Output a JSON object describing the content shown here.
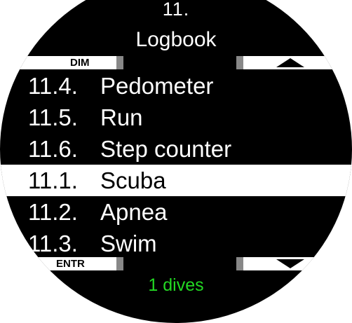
{
  "header": {
    "number": "11.",
    "title": "Logbook"
  },
  "buttons": {
    "top_left": "DIM",
    "bottom_left": "ENTR",
    "top_right_icon": "up-arrow-icon",
    "bottom_right_icon": "down-arrow-icon"
  },
  "menu": {
    "items": [
      {
        "number": "11.4.",
        "label": "Pedometer",
        "selected": false
      },
      {
        "number": "11.5.",
        "label": "Run",
        "selected": false
      },
      {
        "number": "11.6.",
        "label": "Step counter",
        "selected": false
      },
      {
        "number": "11.1.",
        "label": "Scuba",
        "selected": true
      },
      {
        "number": "11.2.",
        "label": "Apnea",
        "selected": false
      },
      {
        "number": "11.3.",
        "label": "Swim",
        "selected": false
      }
    ]
  },
  "footer": {
    "status": "1 dives"
  },
  "colors": {
    "background": "#000000",
    "text": "#ffffff",
    "status": "#23d823",
    "highlight": "#ffffff"
  }
}
